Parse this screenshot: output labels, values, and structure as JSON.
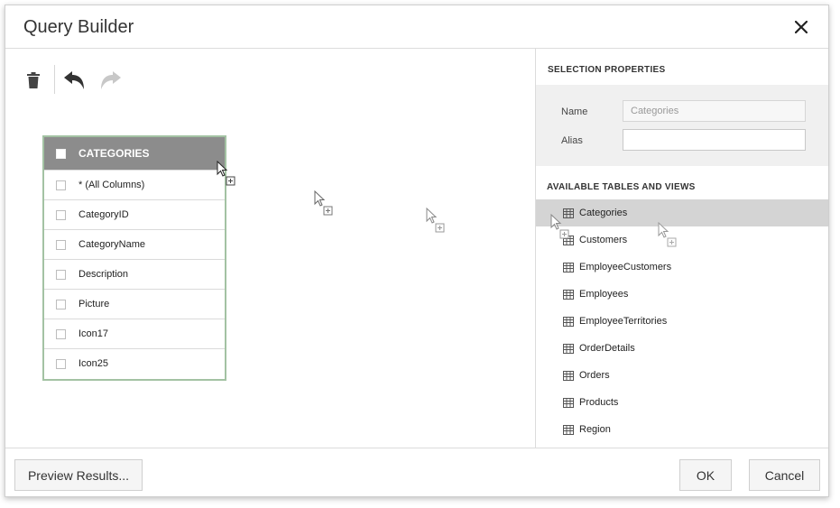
{
  "dialog": {
    "title": "Query Builder"
  },
  "toolbar": {
    "delete_icon": "trash-icon",
    "undo_icon": "undo-icon",
    "redo_icon": "redo-icon"
  },
  "table_card": {
    "name": "CATEGORIES",
    "columns": [
      "* (All Columns)",
      "CategoryID",
      "CategoryName",
      "Description",
      "Picture",
      "Icon17",
      "Icon25"
    ]
  },
  "selection_properties": {
    "title": "SELECTION PROPERTIES",
    "name_label": "Name",
    "name_value": "Categories",
    "alias_label": "Alias",
    "alias_value": ""
  },
  "available_tables": {
    "title": "AVAILABLE TABLES AND VIEWS",
    "selected": "Categories",
    "items": [
      "Categories",
      "Customers",
      "EmployeeCustomers",
      "Employees",
      "EmployeeTerritories",
      "OrderDetails",
      "Orders",
      "Products",
      "Region"
    ]
  },
  "footer": {
    "preview_label": "Preview Results...",
    "ok_label": "OK",
    "cancel_label": "Cancel"
  },
  "colors": {
    "table_header": "#8c8c8c",
    "table_border": "#a3c2a3",
    "selected_row": "#d4d4d4",
    "props_panel": "#f0f0f0"
  }
}
